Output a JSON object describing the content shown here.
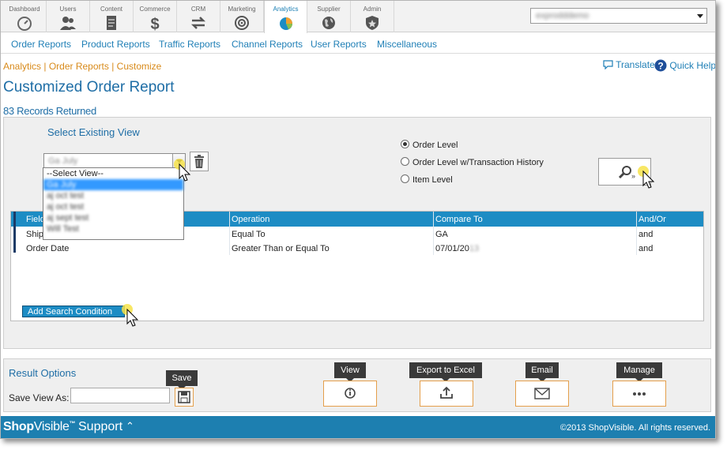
{
  "modules": [
    {
      "label": "Dashboard",
      "icon": "gauge-icon"
    },
    {
      "label": "Users",
      "icon": "users-icon"
    },
    {
      "label": "Content",
      "icon": "document-icon"
    },
    {
      "label": "Commerce",
      "icon": "dollar-icon"
    },
    {
      "label": "CRM",
      "icon": "arrows-icon"
    },
    {
      "label": "Marketing",
      "icon": "target-icon"
    },
    {
      "label": "Analytics",
      "icon": "pie-chart-icon",
      "active": true
    },
    {
      "label": "Supplier",
      "icon": "globe-icon"
    },
    {
      "label": "Admin",
      "icon": "shield-icon"
    }
  ],
  "account_select": {
    "value": "exprodddemo"
  },
  "subnav": [
    "Order Reports",
    "Product Reports",
    "Traffic Reports",
    "Channel Reports",
    "User Reports",
    "Miscellaneous"
  ],
  "breadcrumb": {
    "part1": "Analytics",
    "sep1": " | ",
    "part2": "Order Reports",
    "sep2": " | ",
    "part3": "Customize"
  },
  "help": {
    "translate": "Translate",
    "quick_help": "Quick Help"
  },
  "page_title": "Customized Order Report",
  "records": "83 Records Returned",
  "filter": {
    "select_view_title": "Select Existing View",
    "selected_view": "Ga July",
    "view_options": [
      "--Select View--",
      "Ga July",
      "aj oct test",
      "aj oct test",
      "aj sept test",
      "Will Test"
    ],
    "levels": [
      {
        "label": "Order Level",
        "checked": true
      },
      {
        "label": "Order Level w/Transaction History",
        "checked": false
      },
      {
        "label": "Item Level",
        "checked": false
      }
    ]
  },
  "grid": {
    "columns": [
      "Field",
      "Operation",
      "Compare To",
      "And/Or"
    ],
    "rows": [
      {
        "field": "Ship",
        "operation": "Equal To",
        "compare": "GA",
        "andor": "and"
      },
      {
        "field": "Order Date",
        "operation": "Greater Than or Equal To",
        "compare": "07/01/20",
        "andor": "and"
      }
    ],
    "add_condition": "Add Search Condition"
  },
  "result_options": {
    "title": "Result Options",
    "save_view_label": "Save View As:",
    "save_tip": "Save",
    "actions": [
      {
        "tip": "View",
        "icon": "info-icon"
      },
      {
        "tip": "Export to Excel",
        "icon": "upload-icon"
      },
      {
        "tip": "Email",
        "icon": "envelope-icon"
      },
      {
        "tip": "Manage",
        "icon": "more-icon"
      }
    ]
  },
  "footer": {
    "brand_shop": "Shop",
    "brand_visible": "Visible",
    "tm": "™",
    "support": "Support",
    "caret": "⌃",
    "copyright": "©2013 ShopVisible. All rights reserved."
  },
  "colors": {
    "accent": "#1d8cc4",
    "link": "#1f7fb6",
    "breadcrumb": "#d88a1a",
    "footer": "#1d7fb0"
  }
}
